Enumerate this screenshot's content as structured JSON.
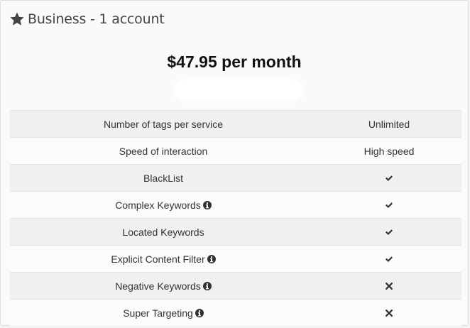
{
  "card": {
    "title": "Business - 1 account",
    "title_icon": "star-icon",
    "price": "$47.95 per month"
  },
  "features": [
    {
      "name": "Number of tags per service",
      "info": false,
      "value": "Unlimited",
      "value_type": "text"
    },
    {
      "name": "Speed of interaction",
      "info": false,
      "value": "High speed",
      "value_type": "text"
    },
    {
      "name": "BlackList",
      "info": false,
      "value": "check-icon",
      "value_type": "icon"
    },
    {
      "name": "Complex Keywords",
      "info": true,
      "value": "check-icon",
      "value_type": "icon"
    },
    {
      "name": "Located Keywords",
      "info": false,
      "value": "check-icon",
      "value_type": "icon"
    },
    {
      "name": "Explicit Content Filter",
      "info": true,
      "value": "check-icon",
      "value_type": "icon"
    },
    {
      "name": "Negative Keywords",
      "info": true,
      "value": "cross-icon",
      "value_type": "icon"
    },
    {
      "name": "Super Targeting",
      "info": true,
      "value": "cross-icon",
      "value_type": "icon"
    }
  ],
  "colors": {
    "text": "#333333",
    "stripe": "#f0f0f0",
    "background": "#fafafa"
  }
}
